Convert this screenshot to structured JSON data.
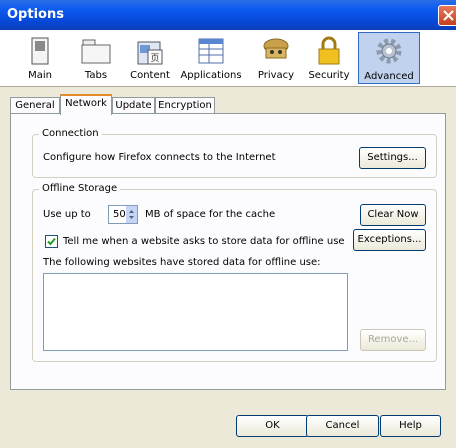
{
  "window": {
    "title": "Options"
  },
  "toolbar": {
    "items": [
      {
        "label": "Main",
        "icon": "switch-icon"
      },
      {
        "label": "Tabs",
        "icon": "tabs-icon"
      },
      {
        "label": "Content",
        "icon": "content-icon"
      },
      {
        "label": "Applications",
        "icon": "applications-icon"
      },
      {
        "label": "Privacy",
        "icon": "privacy-mask-icon"
      },
      {
        "label": "Security",
        "icon": "lock-icon"
      },
      {
        "label": "Advanced",
        "icon": "gear-icon"
      }
    ],
    "selected": "Advanced"
  },
  "tabs": [
    "General",
    "Network",
    "Update",
    "Encryption"
  ],
  "active_tab": "Network",
  "connection": {
    "legend": "Connection",
    "description": "Configure how Firefox connects to the Internet",
    "settings_button": "Settings..."
  },
  "offline": {
    "legend": "Offline Storage",
    "use_up_to": "Use up to",
    "cache_value": "50",
    "cache_units": "MB of space for the cache",
    "clear_now": "Clear Now",
    "tell_me": "Tell me when a website asks to store data for offline use",
    "tell_me_checked": true,
    "exceptions": "Exceptions...",
    "sites_label": "The following websites have stored data for offline use:",
    "remove": "Remove..."
  },
  "footer": {
    "ok": "OK",
    "cancel": "Cancel",
    "help": "Help"
  },
  "colors": {
    "titlebar": "#0a55e0",
    "selected_toolbar": "#c1d2ee",
    "active_tab_accent": "#e68b2c"
  }
}
